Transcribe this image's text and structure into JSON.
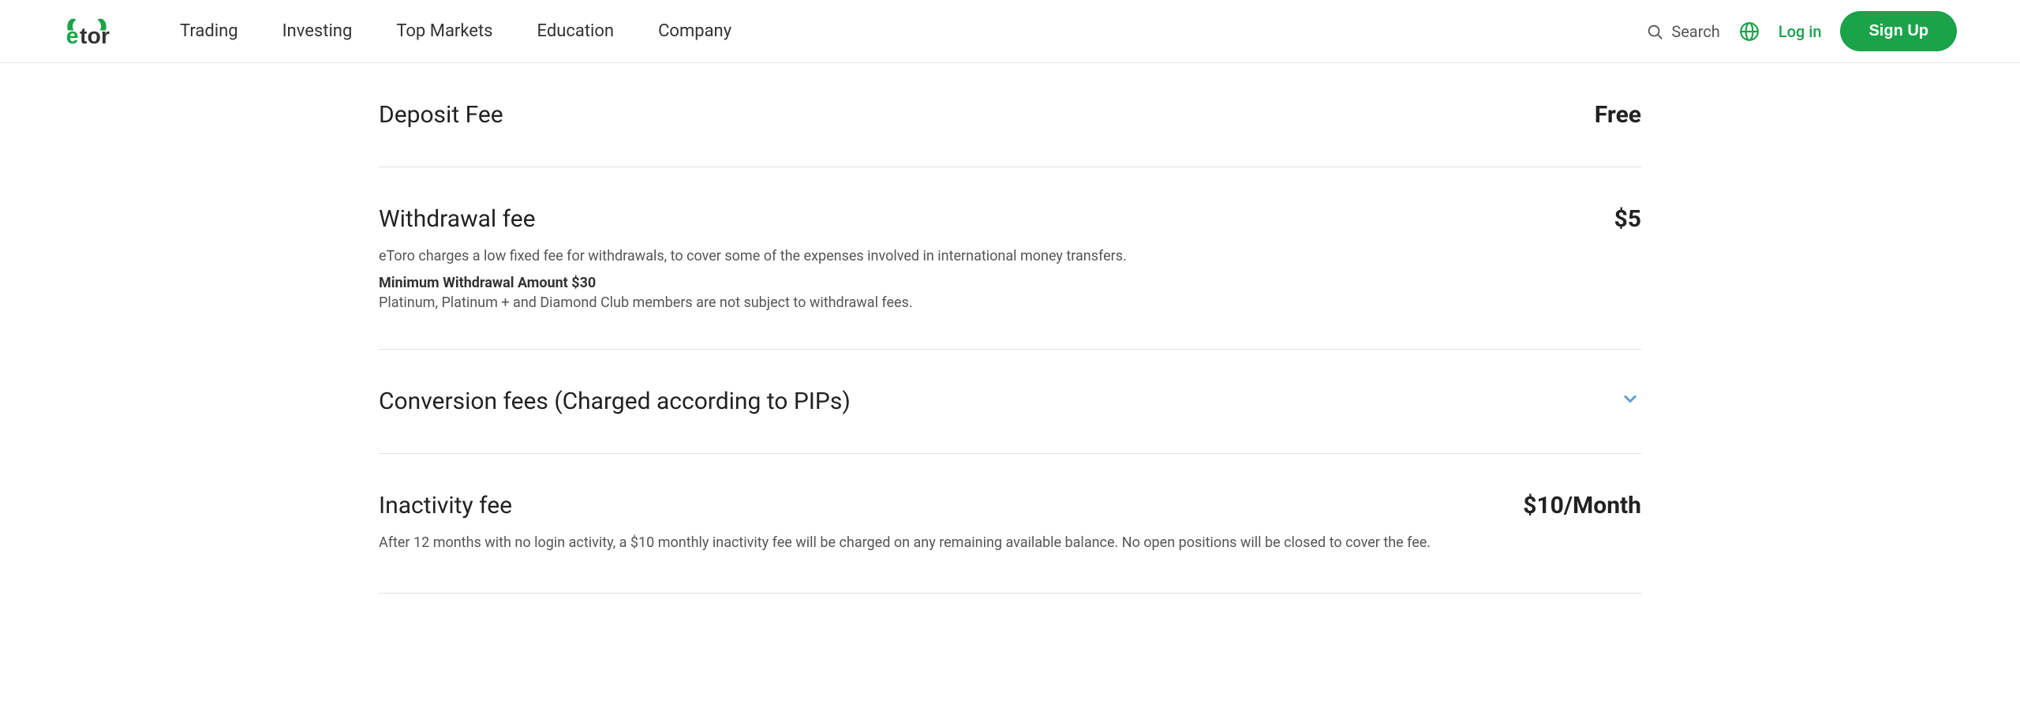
{
  "navbar": {
    "logo_text": "etoro",
    "nav_items": [
      {
        "label": "Trading",
        "id": "trading"
      },
      {
        "label": "Investing",
        "id": "investing"
      },
      {
        "label": "Top Markets",
        "id": "top-markets"
      },
      {
        "label": "Education",
        "id": "education"
      },
      {
        "label": "Company",
        "id": "company"
      }
    ],
    "search_label": "Search",
    "login_label": "Log in",
    "signup_label": "Sign Up"
  },
  "fees": [
    {
      "id": "deposit-fee",
      "title": "Deposit Fee",
      "value": "Free",
      "has_description": false,
      "has_chevron": false
    },
    {
      "id": "withdrawal-fee",
      "title": "Withdrawal fee",
      "value": "$5",
      "has_description": true,
      "description": "eToro charges a low fixed fee for withdrawals, to cover some of the expenses involved in international money transfers.",
      "note_bold": "Minimum Withdrawal Amount $30",
      "note": "Platinum, Platinum + and Diamond Club members are not subject to withdrawal fees.",
      "has_chevron": false
    },
    {
      "id": "conversion-fee",
      "title": "Conversion fees (Charged according to PIPs)",
      "value": "",
      "has_description": false,
      "has_chevron": true
    },
    {
      "id": "inactivity-fee",
      "title": "Inactivity fee",
      "value": "$10/Month",
      "has_description": true,
      "description": "After 12 months with no login activity, a $10 monthly inactivity fee will be charged on any remaining available balance. No open positions will be closed to cover the fee.",
      "note_bold": "",
      "note": "",
      "has_chevron": false
    }
  ]
}
